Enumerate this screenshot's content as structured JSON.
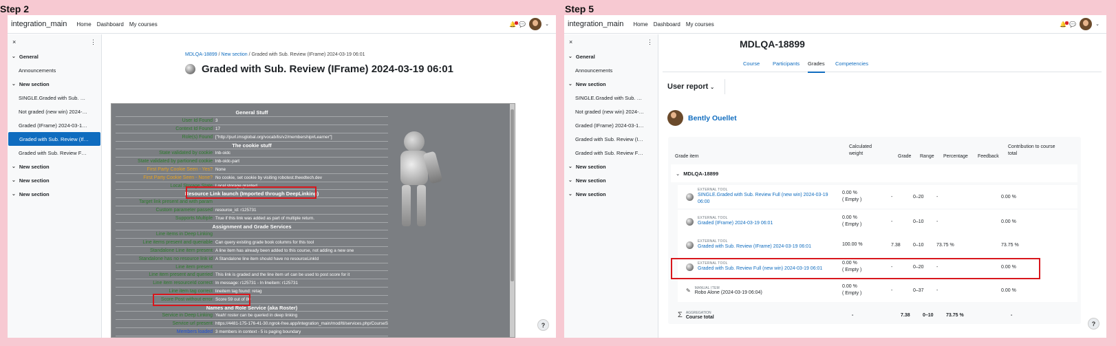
{
  "step_left": "Step 2",
  "step_right": "Step 5",
  "navbar": {
    "brand": "integration_main",
    "links": [
      "Home",
      "Dashboard",
      "My courses"
    ]
  },
  "drawer": {
    "close_glyph": "×",
    "menu_glyph": "⋮",
    "sections_left": [
      {
        "title": "General",
        "items": [
          "Announcements"
        ]
      },
      {
        "title": "New section",
        "items": [
          "SINGLE.Graded with Sub. …",
          "Not graded (new win) 2024-…",
          "Graded (IFrame) 2024-03-1…",
          "Graded with Sub. Review (If…",
          "Graded with Sub. Review F…"
        ]
      },
      {
        "title": "New section",
        "items": []
      },
      {
        "title": "New section",
        "items": []
      },
      {
        "title": "New section",
        "items": []
      }
    ],
    "sections_right": [
      {
        "title": "General",
        "items": [
          "Announcements"
        ]
      },
      {
        "title": "New section",
        "items": [
          "SINGLE.Graded with Sub. …",
          "Not graded (new win) 2024-…",
          "Graded (IFrame) 2024-03-1…",
          "Graded with Sub. Review (I…",
          "Graded with Sub. Review F…"
        ]
      },
      {
        "title": "New section",
        "items": []
      },
      {
        "title": "New section",
        "items": []
      },
      {
        "title": "New section",
        "items": []
      }
    ],
    "active_left_index": 3
  },
  "activity": {
    "breadcrumb": [
      "MDLQA-18899",
      "New section",
      "Graded with Sub. Review (IFrame) 2024-03-19 06:01"
    ],
    "title": "Graded with Sub. Review (IFrame) 2024-03-19 06:01"
  },
  "lti_rows": [
    {
      "type": "hdr",
      "v": "General Stuff"
    },
    {
      "k": "User Id Found",
      "v": "3"
    },
    {
      "k": "Context Id Found",
      "v": "17"
    },
    {
      "k": "Role(s) Found",
      "v": "[\"http://purl.imsglobal.org/vocab/lis/v2/membership#Learner\"]"
    },
    {
      "type": "hdr",
      "v": "The cookie stuff"
    },
    {
      "k": "State validated by cookie",
      "v": "lnb-oidc"
    },
    {
      "k": "State validated by partioned cookie",
      "v": "lnb-oidc-part"
    },
    {
      "k": "First Party Cookie Seen - Yes?",
      "v": "None",
      "cls": "warn"
    },
    {
      "k": "First Party Cookie Seen - None?",
      "v": "No cookie, set cookie by visiting robotest.theedtech.dev",
      "cls": "warn"
    },
    {
      "k": "Local Storage State",
      "v": "Local storage granted"
    },
    {
      "type": "hdr",
      "v": "Resource Link launch (Imported through DeepLinking)"
    },
    {
      "k": "Target link present and with param",
      "v": ""
    },
    {
      "k": "Custom parameter passed",
      "v": "resource_id: r125731"
    },
    {
      "k": "Supports Multiple",
      "v": "True if this link was added as part of multiple return."
    },
    {
      "type": "hdr",
      "v": "Assignment and Grade Services"
    },
    {
      "k": "Line items in Deep Linking",
      "v": ""
    },
    {
      "k": "Line items present and queriable",
      "v": "Can query existing grade book columns for this tool"
    },
    {
      "k": "Standalone Line item present",
      "v": "A line item has already been added to this course, not adding a new one"
    },
    {
      "k": "Standalone has no resource link id",
      "v": "A Standalone line item should have no resourceLinkId"
    },
    {
      "k": "Line item present",
      "v": ""
    },
    {
      "k": "Line item present and queried",
      "v": "This link is graded and the line item url can be used to post score for it"
    },
    {
      "k": "Line item resourceId correct",
      "v": "In message: r125731 - In lineitem: r125731"
    },
    {
      "k": "Line item tag correct",
      "v": "lineitem tag found: retag"
    },
    {
      "k": "Score Post without error",
      "v": "Score 59 out of 80"
    },
    {
      "type": "hdr",
      "v": "Names and Role Service (aka Roster)"
    },
    {
      "k": "Service in Deep Linking",
      "v": "Yeah! roster can be queried in deep linking"
    },
    {
      "k": "Service url present",
      "v": "https://4481-175-176-41-30.ngrok-free.app/integration_main/mod/lti/services.php/CourseSection/17/bindings/1/memberships"
    },
    {
      "k": "Members loaded",
      "v": "3 members in context - 5 is paging boundary",
      "cls": "blue"
    }
  ],
  "course": {
    "title": "MDLQA-18899",
    "tabs": [
      "Course",
      "Participants",
      "Grades",
      "Competencies"
    ],
    "active_tab": 2,
    "report": "User report",
    "user": "Bently Ouellet"
  },
  "grades": {
    "headers": {
      "item": "Grade item",
      "weight_1": "Calculated",
      "weight_2": "weight",
      "grade": "Grade",
      "range": "Range",
      "percentage": "Percentage",
      "feedback": "Feedback",
      "contrib_1": "Contribution to course",
      "contrib_2": "total"
    },
    "category": "MDLQA-18899",
    "rows": [
      {
        "meta": "EXTERNAL TOOL",
        "name1": "SINGLE.Graded with Sub. Review Full (new win) 2024-03-19",
        "name2": "06:00",
        "weight": "0.00 %",
        "empty": "( Empty )",
        "grade": "-",
        "range": "0–20",
        "pct": "-",
        "contrib": "0.00 %",
        "link": true
      },
      {
        "meta": "EXTERNAL TOOL",
        "name1": "Graded (IFrame) 2024-03-19 06:01",
        "name2": "",
        "weight": "0.00 %",
        "empty": "( Empty )",
        "grade": "-",
        "range": "0–10",
        "pct": "-",
        "contrib": "0.00 %",
        "link": true
      },
      {
        "meta": "EXTERNAL TOOL",
        "name1": "Graded with Sub. Review (IFrame) 2024-03-19 06:01",
        "name2": "",
        "weight": "100.00 %",
        "empty": "",
        "grade": "7.38",
        "range": "0–10",
        "pct": "73.75 %",
        "contrib": "73.75 %",
        "link": true
      },
      {
        "meta": "EXTERNAL TOOL",
        "name1": "Graded with Sub. Review Full (new win) 2024-03-19 06:01",
        "name2": "",
        "weight": "0.00 %",
        "empty": "( Empty )",
        "grade": "-",
        "range": "0–20",
        "pct": "-",
        "contrib": "0.00 %",
        "link": true
      },
      {
        "meta": "MANUAL ITEM",
        "name1": "Robo Alone (2024-03-19 06:04)",
        "name2": "",
        "weight": "0.00 %",
        "empty": "( Empty )",
        "grade": "-",
        "range": "0–37",
        "pct": "-",
        "contrib": "0.00 %",
        "link": false
      }
    ],
    "total": {
      "meta": "AGGREGATION",
      "label": "Course total",
      "weight": "-",
      "grade": "7.38",
      "range": "0–10",
      "pct": "73.75 %",
      "contrib": "-"
    }
  },
  "help_glyph": "?"
}
